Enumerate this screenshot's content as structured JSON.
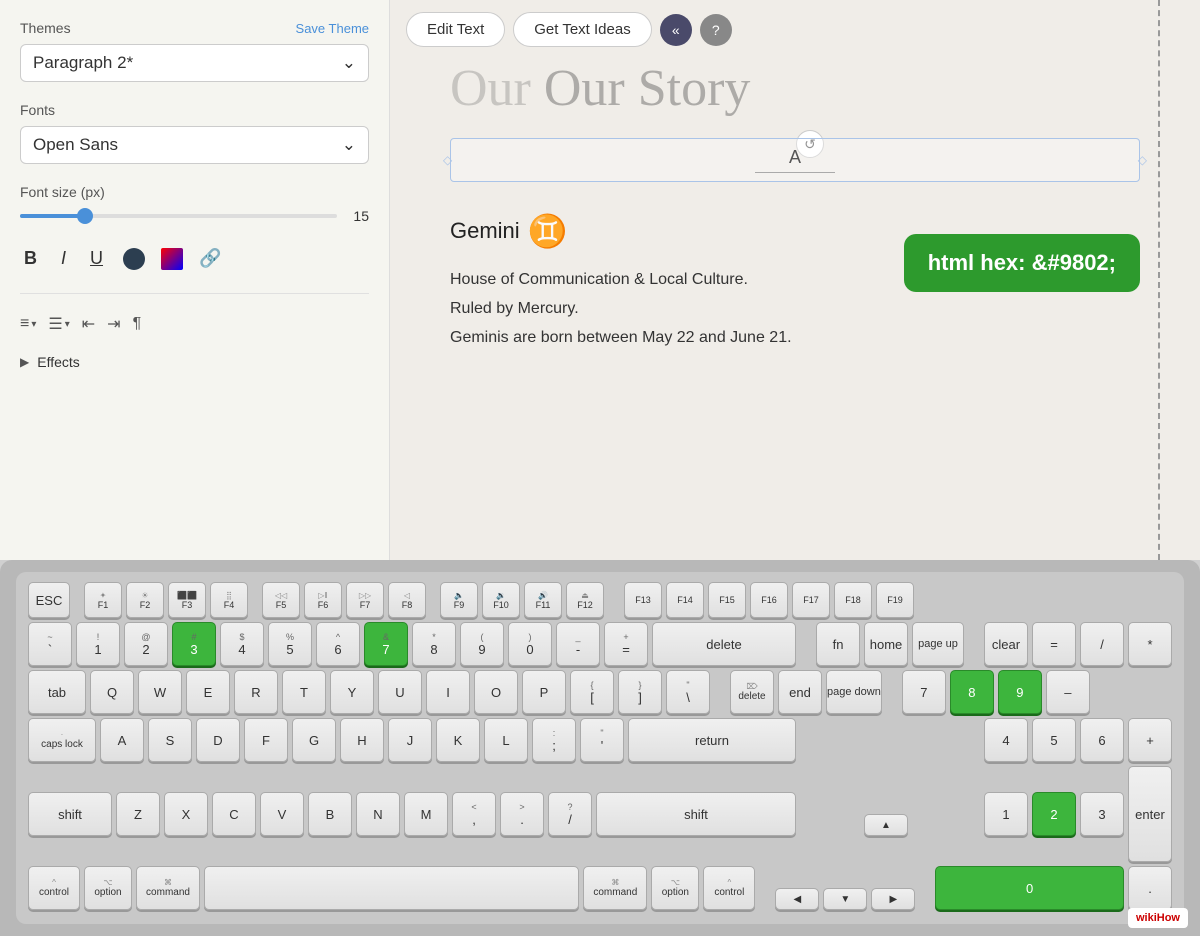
{
  "leftPanel": {
    "themesLabel": "Themes",
    "saveThemeLabel": "Save Theme",
    "paragraphValue": "Paragraph 2*",
    "fontsLabel": "Fonts",
    "fontValue": "Open Sans",
    "fontSizeLabel": "Font size (px)",
    "fontSizeValue": "15",
    "sliderPercent": "20",
    "effectsLabel": "Effects",
    "formatButtons": {
      "bold": "B",
      "italic": "I",
      "underline": "U"
    }
  },
  "rightPanel": {
    "editTextBtn": "Edit Text",
    "getTextIdeasBtn": "Get Text Ideas",
    "navBtnLabel": "«",
    "helpBtnLabel": "?",
    "storyTitle": "Our Story",
    "textInputValue": "A",
    "geminiTitle": "Gemini",
    "geminiSymbol": "♊",
    "geminiLine1": "House of Communication & Local Culture.",
    "geminiLine2": "Ruled by Mercury.",
    "geminiLine3": "Geminis are born between May 22 and June 21.",
    "htmlHexLabel": "html hex: &#9802;"
  },
  "keyboard": {
    "fnRow": [
      "ESC",
      "F1",
      "F2",
      "F3",
      "F4",
      "F5",
      "F6",
      "F7",
      "F8",
      "F9",
      "F10",
      "F11",
      "F12",
      "F13",
      "F14",
      "F15",
      "F16",
      "F17",
      "F18",
      "F19"
    ],
    "row1": [
      "`",
      "1",
      "2",
      "#3",
      "$4",
      "%5",
      "^6",
      "&7",
      "*8",
      "(9",
      ")0",
      "-",
      "=",
      "delete"
    ],
    "row2": [
      "tab",
      "Q",
      "W",
      "E",
      "R",
      "T",
      "Y",
      "U",
      "I",
      "O",
      "P",
      "{[",
      "}]",
      "\\|"
    ],
    "row3": [
      "caps lock",
      "A",
      "S",
      "D",
      "F",
      "G",
      "H",
      "J",
      "K",
      "L",
      ";:",
      "'\"",
      "return"
    ],
    "row4": [
      "shift",
      "Z",
      "X",
      "C",
      "V",
      "B",
      "N",
      "M",
      "<,",
      ">.",
      "?/",
      "shift"
    ],
    "row5": [
      "control",
      "option",
      "command",
      "",
      "command",
      "option",
      "control"
    ],
    "greenKeys": [
      "3",
      "7",
      "8",
      "9",
      "2",
      "0"
    ]
  },
  "colors": {
    "accent": "#4a90d9",
    "green": "#3db53d",
    "darkGreen": "#2a8a2a"
  },
  "wikihow": {
    "badge": "wikiHow"
  }
}
